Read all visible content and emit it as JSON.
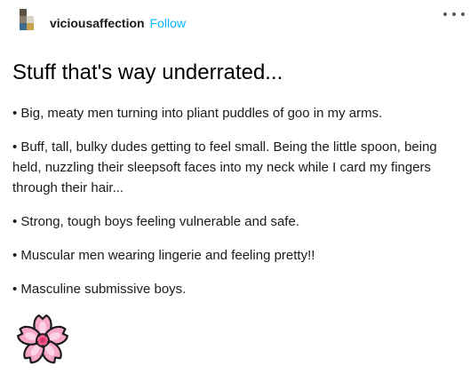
{
  "header": {
    "blog_name": "viciousaffection",
    "follow_label": "Follow",
    "more_icon": "more-horizontal-icon",
    "avatar_colors": [
      "#5c5246",
      "#8a7d6c",
      "#c9a24a",
      "#3b6c8e"
    ]
  },
  "post": {
    "title": "Stuff that's way underrated...",
    "paragraphs": [
      "• Big, meaty men turning into pliant puddles of goo in my arms.",
      "• Buff, tall, bulky dudes getting to feel small. Being the little spoon, being held, nuzzling their sleepsoft faces into my neck while I card my fingers through their hair...",
      "• Strong, tough boys feeling vulnerable and safe.",
      "• Muscular men wearing lingerie and feeling pretty!!",
      "• Masculine submissive boys."
    ],
    "emoji_icon": "cherry-blossom-icon"
  },
  "colors": {
    "accent": "#00b8ff",
    "flower_fill": "#f7a6c8",
    "flower_center": "#d6336c"
  }
}
